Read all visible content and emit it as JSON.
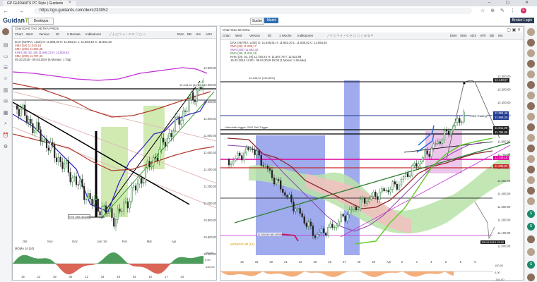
{
  "browser": {
    "tab_title": "GP GUIDANTS PC Style | Guidants",
    "url": "https://go.guidants.com/de#c233052",
    "nav_icons": "← → ⟳",
    "window_controls": "– ▢ ✕",
    "toolbar_icons": "☆ ⊕ ✎ ⋮",
    "profile_initial": "K"
  },
  "app": {
    "logo_main": "Guidan",
    "logo_accent": "TS",
    "desktops_label": "Desktops",
    "search_label": "Suche",
    "markt_label": "Markt",
    "login_label": "Broker Login"
  },
  "left_chart": {
    "title": "Chart DAX TAG XETRA PREIS",
    "toolbar": [
      "Chart",
      "Wert",
      "Version",
      "5h",
      "6 Monate",
      "Indikatoren"
    ],
    "toolbar_right": [
      "EMA",
      "BB",
      "Hrs",
      "ADX"
    ],
    "legend": [
      {
        "text": "DAX (XETRA, Letzt) O: 11.809,40 H: 11.864,21 L: 11.804,40 C: 11.864,40",
        "color": "#333333"
      },
      {
        "text": "SMA (50) 11.543,18",
        "color": "#b03a2e"
      },
      {
        "text": "SMA (200) 11.563,35",
        "color": "#b03a2e"
      },
      {
        "text": "KHKI (26, 52, 26) 11.590,22 H: 11.604,63",
        "color": "#7d3cb8"
      },
      {
        "text": "SMA (200) 11.737,46",
        "color": "#b03a2e"
      },
      {
        "text": "09.10.2018 - 09.04.2019 (6 Monate, 1 Tag)",
        "color": "#333333"
      }
    ],
    "price_labels": [
      "12.600,00",
      "12.400,00",
      "12.200,00",
      "12.000,00",
      "11.800,00",
      "11.600,00",
      "11.400,00",
      "11.200,00",
      "11.000,00",
      "10.800,00",
      "10.600,00",
      "10.400,00"
    ],
    "x_labels": [
      "Okt",
      "Nov",
      "Dez",
      "Jan '19",
      "Feb",
      "Mär",
      "Apr"
    ],
    "x_labels_bottom": [
      "15",
      "22",
      "29",
      "05",
      "12",
      "19",
      "26",
      "03",
      "10",
      "17",
      "24"
    ],
    "annotation_low": "SHS Ziel: 10.225",
    "annotation_high": "12.445,51 (61,80%)",
    "indicator_label": "MOMA 14 (10)",
    "indicator_values": [
      "150,00",
      "0,00",
      "-150,00"
    ]
  },
  "right_chart": {
    "title": "Chart Dax 60 Xetra",
    "toolbar": [
      "Chart",
      "Wert",
      "Version",
      "5h",
      "1 Woche",
      "Indikatoren"
    ],
    "toolbar_right": [
      "EMA",
      "SMA",
      "ADX",
      "ATR",
      "BB",
      "MA"
    ],
    "legend": [
      {
        "text": "DAX (XETRA, Letzt) O: 11.845,91 H: 11.861,20 L: 11.830,52 C: 11.854,40",
        "color": "#333333"
      },
      {
        "text": "SMA (50) 11.808,17",
        "color": "#b03a2e"
      },
      {
        "text": "SMA (200) 11.652,32",
        "color": "#8e44ad"
      },
      {
        "text": "EMA (26) 11.831,28",
        "color": "#2e7d32"
      },
      {
        "text": "KHKI (26, 52, 26) 11.750,24 H: 11.807,78 T: 11.832,94",
        "color": "#333333"
      },
      {
        "text": "15.03.2019 12:00 - 09.04.2019 15:00 (1 Monat, 1 Stunde)",
        "color": "#333333"
      }
    ],
    "price_labels": [
      "12.300,00",
      "12.200,00",
      "12.100,00",
      "12.000,00",
      "11.900,00",
      "11.800,00",
      "11.700,00",
      "11.600,00",
      "11.500,00",
      "11.400,00",
      "11.300,00",
      "11.200,00",
      "11.100,00",
      "11.000,00"
    ],
    "price_tags": [
      {
        "text": "12.148,57",
        "bg": "#222222"
      },
      {
        "text": "11.854,40",
        "bg": "#1f3a93"
      },
      {
        "text": "11.868,26",
        "bg": "#1f3a93"
      },
      {
        "text": "11.811,28",
        "bg": "#222222"
      },
      {
        "text": "11.794,06",
        "bg": "#222222"
      },
      {
        "text": "11.718,10",
        "bg": "#e000a0"
      },
      {
        "text": "11.635,63",
        "bg": "#c62828"
      }
    ],
    "x_labels": [
      "18",
      "19",
      "20",
      "21",
      "22",
      "25",
      "26",
      "27",
      "28",
      "29",
      "Apr",
      "2",
      "3",
      "4",
      "5",
      "8",
      "9"
    ],
    "annotation_top": "12.148,57 (161,80%)",
    "annotation_sell": "Unterhalb trigger: SHS Sell Trigger",
    "annotation_tag": "DAX Trading",
    "annotation_date": "05.04.2019 15:00",
    "annotation_fib": "11.284,90 (61,80%)",
    "indicator_label": "MOMENTUM (10)",
    "indicator_values": [
      "150,00",
      "0,00",
      "-150,00"
    ]
  },
  "sidebar_icons": [
    "avatar",
    "chart-icon",
    "monitor-icon",
    "watchlist-icon",
    "people-icon",
    "depot-icon",
    "news-icon",
    "calendar-icon",
    "screener-icon",
    "alarm-icon",
    "settings-icon"
  ],
  "colors": {
    "candle_up": "#1a7a2a",
    "candle_down": "#222222",
    "ichimoku_cloud_up": "#b7e3a8",
    "ichimoku_cloud_down": "#f1c0c0",
    "blue_zone": "#7f8fe6",
    "green_zone": "#cbe8a9",
    "pink_zone": "#e7b8e6",
    "fill_positive": "#2e8b3f",
    "fill_negative": "#d44b3a"
  }
}
